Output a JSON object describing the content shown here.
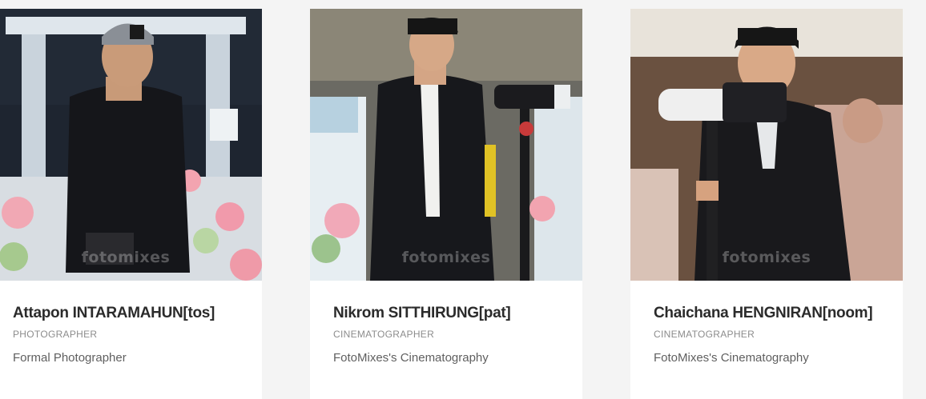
{
  "team": [
    {
      "name": "Attapon INTARAMAHUN[tos]",
      "role": "PHOTOGRAPHER",
      "description": "Formal Photographer",
      "watermark": "fotomixes"
    },
    {
      "name": "Nikrom SITTHIRUNG[pat]",
      "role": "CINEMATOGRAPHER",
      "description": "FotoMixes's Cinematography",
      "watermark": "fotomixes"
    },
    {
      "name": "Chaichana HENGNIRAN[noom]",
      "role": "CINEMATOGRAPHER",
      "description": "FotoMixes's Cinematography",
      "watermark": "fotomixes"
    }
  ]
}
